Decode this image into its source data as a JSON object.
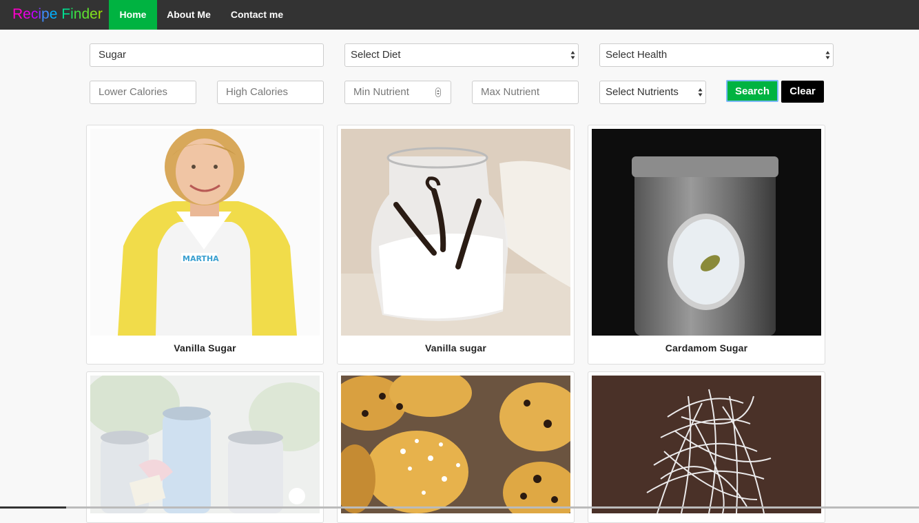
{
  "brand": {
    "letters": [
      {
        "ch": "R",
        "color": "#ff00cc"
      },
      {
        "ch": "e",
        "color": "#e600e6"
      },
      {
        "ch": "c",
        "color": "#c000ff"
      },
      {
        "ch": "i",
        "color": "#8040ff"
      },
      {
        "ch": "p",
        "color": "#3f8cff"
      },
      {
        "ch": "e",
        "color": "#00b0ff"
      },
      {
        "ch": " ",
        "color": "#00d0c0"
      },
      {
        "ch": "F",
        "color": "#00e090"
      },
      {
        "ch": "i",
        "color": "#20e060"
      },
      {
        "ch": "n",
        "color": "#40e040"
      },
      {
        "ch": "d",
        "color": "#60e030"
      },
      {
        "ch": "e",
        "color": "#80e020"
      },
      {
        "ch": "r",
        "color": "#a0e000"
      }
    ]
  },
  "nav": {
    "home": "Home",
    "about": "About Me",
    "contact": "Contact me"
  },
  "search": {
    "query": "Sugar",
    "diet": "Select Diet",
    "health": "Select Health",
    "lower_calories": "Lower Calories",
    "high_calories": "High Calories",
    "min_nutrient": "Min Nutrient",
    "max_nutrient": "Max Nutrient",
    "nutrients": "Select Nutrients",
    "search_label": "Search",
    "clear_label": "Clear"
  },
  "recipes": [
    {
      "title": "Vanilla Sugar"
    },
    {
      "title": "Vanilla sugar"
    },
    {
      "title": "Cardamom Sugar"
    },
    {
      "title": ""
    },
    {
      "title": ""
    },
    {
      "title": ""
    }
  ],
  "colors": {
    "navbar": "#333333",
    "active_nav": "#00b341",
    "search_button": "#00b341",
    "clear_button": "#000000"
  }
}
